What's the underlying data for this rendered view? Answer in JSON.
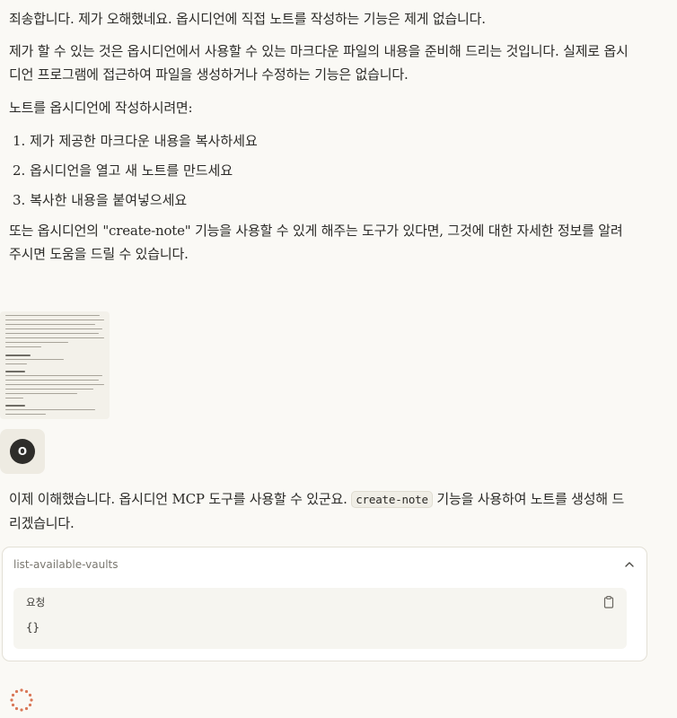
{
  "messages": {
    "p1": "죄송합니다. 제가 오해했네요. 옵시디언에 직접 노트를 작성하는 기능은 제게 없습니다.",
    "p2": "제가 할 수 있는 것은 옵시디언에서 사용할 수 있는 마크다운 파일의 내용을 준비해 드리는 것입니다. 실제로 옵시디언 프로그램에 접근하여 파일을 생성하거나 수정하는 기능은 없습니다.",
    "p3": "노트를 옵시디언에 작성하시려면:",
    "list": [
      "1. 제가 제공한 마크다운 내용을 복사하세요",
      "2. 옵시디언을 열고 새 노트를 만드세요",
      "3. 복사한 내용을 붙여넣으세요"
    ],
    "p4": "또는 옵시디언의 \"create-note\" 기능을 사용할 수 있게 해주는 도구가 있다면, 그것에 대한 자세한 정보를 알려주시면 도움을 드릴 수 있습니다.",
    "p5_before": "이제 이해했습니다. 옵시디언 MCP 도구를 사용할 수 있군요.",
    "p5_code": "create-note",
    "p5_after": "기능을 사용하여 노트를 생성해 드리겠습니다."
  },
  "user": {
    "avatar_initial": "O"
  },
  "tool_call": {
    "name": "list-available-vaults",
    "request_label": "요청",
    "request_body": "{}"
  },
  "icons": {
    "collapse": "chevron-up-icon",
    "copy": "clipboard-icon",
    "loading": "loading-spinner-icon"
  },
  "colors": {
    "background": "#faf9f5",
    "text": "#2b2a27",
    "spinner": "#d97757"
  }
}
